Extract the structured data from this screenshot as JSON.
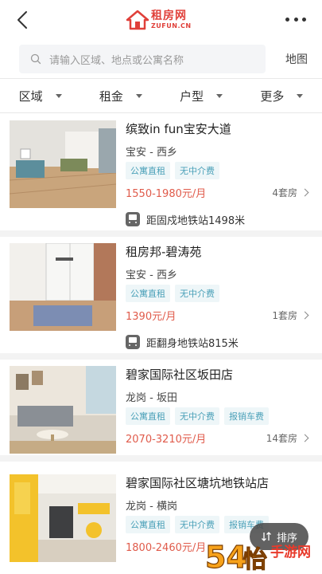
{
  "header": {
    "logo_cn": "租房网",
    "logo_en": "ZUFUN.CN"
  },
  "search": {
    "placeholder": "请输入区域、地点或公寓名称",
    "map_label": "地图"
  },
  "filters": [
    {
      "label": "区域"
    },
    {
      "label": "租金"
    },
    {
      "label": "户型"
    },
    {
      "label": "更多"
    }
  ],
  "listings": [
    {
      "title": "缤致in fun宝安大道",
      "location": "宝安 - 西乡",
      "tags": [
        "公寓直租",
        "无中介费"
      ],
      "price": "1550-1980元/月",
      "rooms": "4套房",
      "metro": "距固戍地铁站1498米"
    },
    {
      "title": "租房邦-碧涛苑",
      "location": "宝安 - 西乡",
      "tags": [
        "公寓直租",
        "无中介费"
      ],
      "price": "1390元/月",
      "rooms": "1套房",
      "metro": "距翻身地铁站815米"
    },
    {
      "title": "碧家国际社区坂田店",
      "location": "龙岗 - 坂田",
      "tags": [
        "公寓直租",
        "无中介费",
        "报销车费"
      ],
      "price": "2070-3210元/月",
      "rooms": "14套房",
      "metro": ""
    },
    {
      "title": "碧家国际社区塘坑地铁站店",
      "location": "龙岗 - 横岗",
      "tags": [
        "公寓直租",
        "无中介费",
        "报销车费"
      ],
      "price": "1800-2460元/月",
      "rooms": "",
      "metro": ""
    }
  ],
  "sort": {
    "label": "排序"
  },
  "watermark": {
    "text": "54怡手游网"
  },
  "colors": {
    "brand": "#e0403a",
    "price": "#e05b4b",
    "tag_text": "#4aa0b8",
    "tag_bg": "#eef6f8"
  }
}
